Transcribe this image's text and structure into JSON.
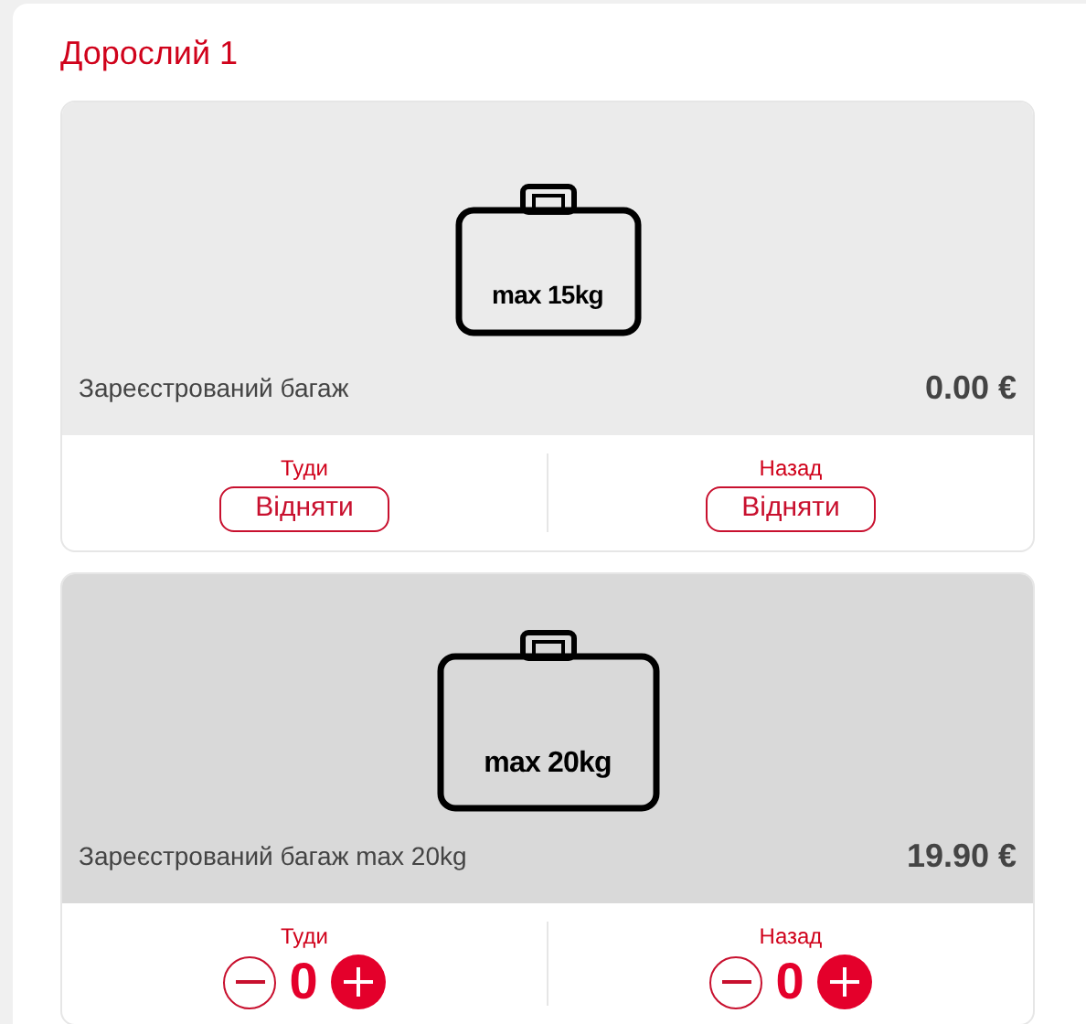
{
  "passenger": {
    "title": "Дорослий 1"
  },
  "options": [
    {
      "kind": "remove",
      "weight_label": "max 15kg",
      "name": "Зареєстрований багаж",
      "price": "0.00 €",
      "legs": [
        {
          "label": "Туди",
          "button": "Відняти"
        },
        {
          "label": "Назад",
          "button": "Відняти"
        }
      ]
    },
    {
      "kind": "counter",
      "weight_label": "max 20kg",
      "name": "Зареєстрований багаж max 20kg",
      "price": "19.90 €",
      "legs": [
        {
          "label": "Туди",
          "count": "0"
        },
        {
          "label": "Назад",
          "count": "0"
        }
      ]
    }
  ]
}
